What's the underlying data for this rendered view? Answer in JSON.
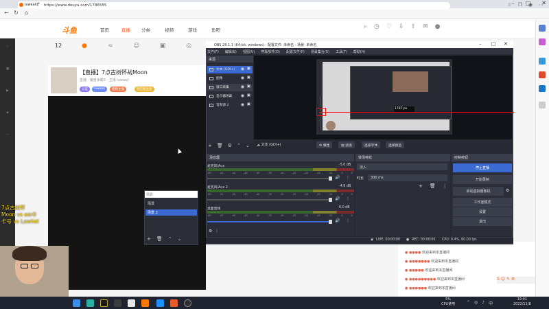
{
  "browser": {
    "tab_title": "lawaail直播_猫咪争霸直播_斗鱼",
    "url": "https://www.douyu.com/1786555"
  },
  "site": {
    "logo": "斗鱼",
    "nav": [
      "首页",
      "直播",
      "分类",
      "视频",
      "游戏",
      "鱼吧"
    ],
    "stat_count": "12",
    "room_title": "【直播】7点古树怀战Moon",
    "room_meta": "直播 · 魔兽争霸3 · 主播 lawaail",
    "pills": [
      "认证",
      "lawaail",
      "超级主播",
      "钻石粉丝团"
    ]
  },
  "overlay_text": [
    "7点古树怀",
    "Moon vs eer0",
    "卡号 vs Lawliet"
  ],
  "scene_panel": {
    "search_placeholder": "场景",
    "items": [
      "场景",
      "场景 2"
    ]
  },
  "obs": {
    "title": "OBS 28.1.1 (64-bit, windows) - 配置文件: 未命名 - 场景: 未命名",
    "menu": [
      "文件(F)",
      "编辑(E)",
      "视图(V)",
      "停靠部件(D)",
      "配置文件(P)",
      "场景集合(S)",
      "工具(T)",
      "帮助(H)"
    ],
    "sources_header": "来源",
    "sources": [
      "文本 (GDI+)",
      "图像",
      "窗口采集",
      "显示器采集",
      "音频源 2"
    ],
    "preview_label": "1787 px",
    "source_toolbar": {
      "selected": "文本 (GDI+)",
      "properties": "属性",
      "filters": "滤镜",
      "select_font": "选择字体",
      "select_color": "选择颜色"
    },
    "mixer": {
      "title": "混音器",
      "channels": [
        {
          "name": "麦克风/Aux",
          "db": "-5.0 dB"
        },
        {
          "name": "麦克风/Aux 2",
          "db": "-4.9 dB"
        },
        {
          "name": "桌面音频",
          "db": "0.0 dB"
        }
      ],
      "scale": [
        "-60",
        "-55",
        "-50",
        "-45",
        "-40",
        "-35",
        "-30",
        "-25",
        "-20",
        "-15",
        "-10",
        "-5",
        "0"
      ]
    },
    "transitions": {
      "title": "转场特效",
      "type": "淡入",
      "duration_label": "时长",
      "duration": "300 ms"
    },
    "controls": {
      "title": "控制按钮",
      "buttons": [
        "停止直播",
        "开始录制",
        "启动虚拟摄像机",
        "工作室模式",
        "设置",
        "退出"
      ]
    },
    "status": {
      "live": "LIVE: 00:00:00",
      "rec": "REC: 00:00:00",
      "cpu": "CPU: 0.4%, 60.00 fps"
    }
  },
  "taskbar": {
    "cpu_pct": "5%",
    "cpu_label": "CPU使用",
    "time": "19:01",
    "date": "2022/11/8"
  },
  "colors": {
    "accent": "#3d6ad1",
    "brand": "#ff7800"
  }
}
